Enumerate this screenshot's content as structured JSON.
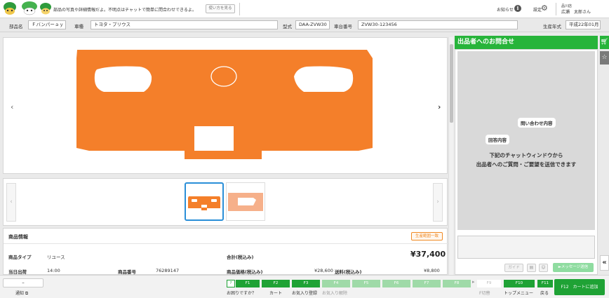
{
  "header": {
    "message": "部品の写真や詳細情報だよ。不明点はチャットで簡単に問合わせできるよ。",
    "howto_button": "使い方を見る",
    "notice_label": "お知らせ",
    "settings_label": "設定",
    "user_store": "品川店",
    "user_name": "広瀬　太郎さん"
  },
  "infobar": {
    "part_name_label": "部品名",
    "part_name_value": "Ｆバンパーａｙ",
    "car_label": "車種",
    "car_value": "トヨタ・プリウス",
    "model_label": "型式",
    "model_value": "DAA-ZVW30",
    "chassis_label": "車台番号",
    "chassis_value": "ZVW30-123456",
    "year_label": "生産年式",
    "year_value": "平成22年01月"
  },
  "main_image": {
    "prev_icon": "chevron-left-icon",
    "next_icon": "chevron-right-icon",
    "color": "#f47f2a"
  },
  "product": {
    "title": "商品情報",
    "badge": "生産範囲一致",
    "type_label": "商品タイプ",
    "type_value": "リユース",
    "total_label": "合計(税込み)",
    "total_value": "¥37,400",
    "ship_label": "当日出荷",
    "ship_value": "14:00",
    "item_no_label": "商品番号",
    "item_no_value": "76289147",
    "price_label": "商品価格(税込み)",
    "price_value": "¥28,600",
    "postage_label": "送料(税込み)",
    "postage_value": "¥8,800"
  },
  "right_panel": {
    "title": "出品者へのお問合せ",
    "bubble_inquiry": "問い合わせ内容",
    "bubble_reply": "回答内容",
    "hint_line1": "下記のチャットウィンドウから",
    "hint_line2": "出品者へのご質問・ご要望を送信できます",
    "guide_button": "ガイド",
    "send_button": "►メッセージ送信"
  },
  "footer": {
    "dash_label": "–",
    "notice_label": "通知",
    "keys": [
      {
        "key": "F1",
        "caption": "お困りですか？"
      },
      {
        "key": "F2",
        "caption": "カート"
      },
      {
        "key": "F3",
        "caption": "お気入り登録"
      },
      {
        "key": "F4",
        "caption": "お気入り解除"
      },
      {
        "key": "F5",
        "caption": ""
      },
      {
        "key": "F6",
        "caption": ""
      },
      {
        "key": "F7",
        "caption": ""
      },
      {
        "key": "F8",
        "caption": ""
      },
      {
        "key": "F9",
        "caption": "F切替"
      },
      {
        "key": "F10",
        "caption": "トップメニュー"
      },
      {
        "key": "F11",
        "caption": "戻る"
      }
    ],
    "f1_badge": "?",
    "f12_label": "F12　カートに追加"
  }
}
